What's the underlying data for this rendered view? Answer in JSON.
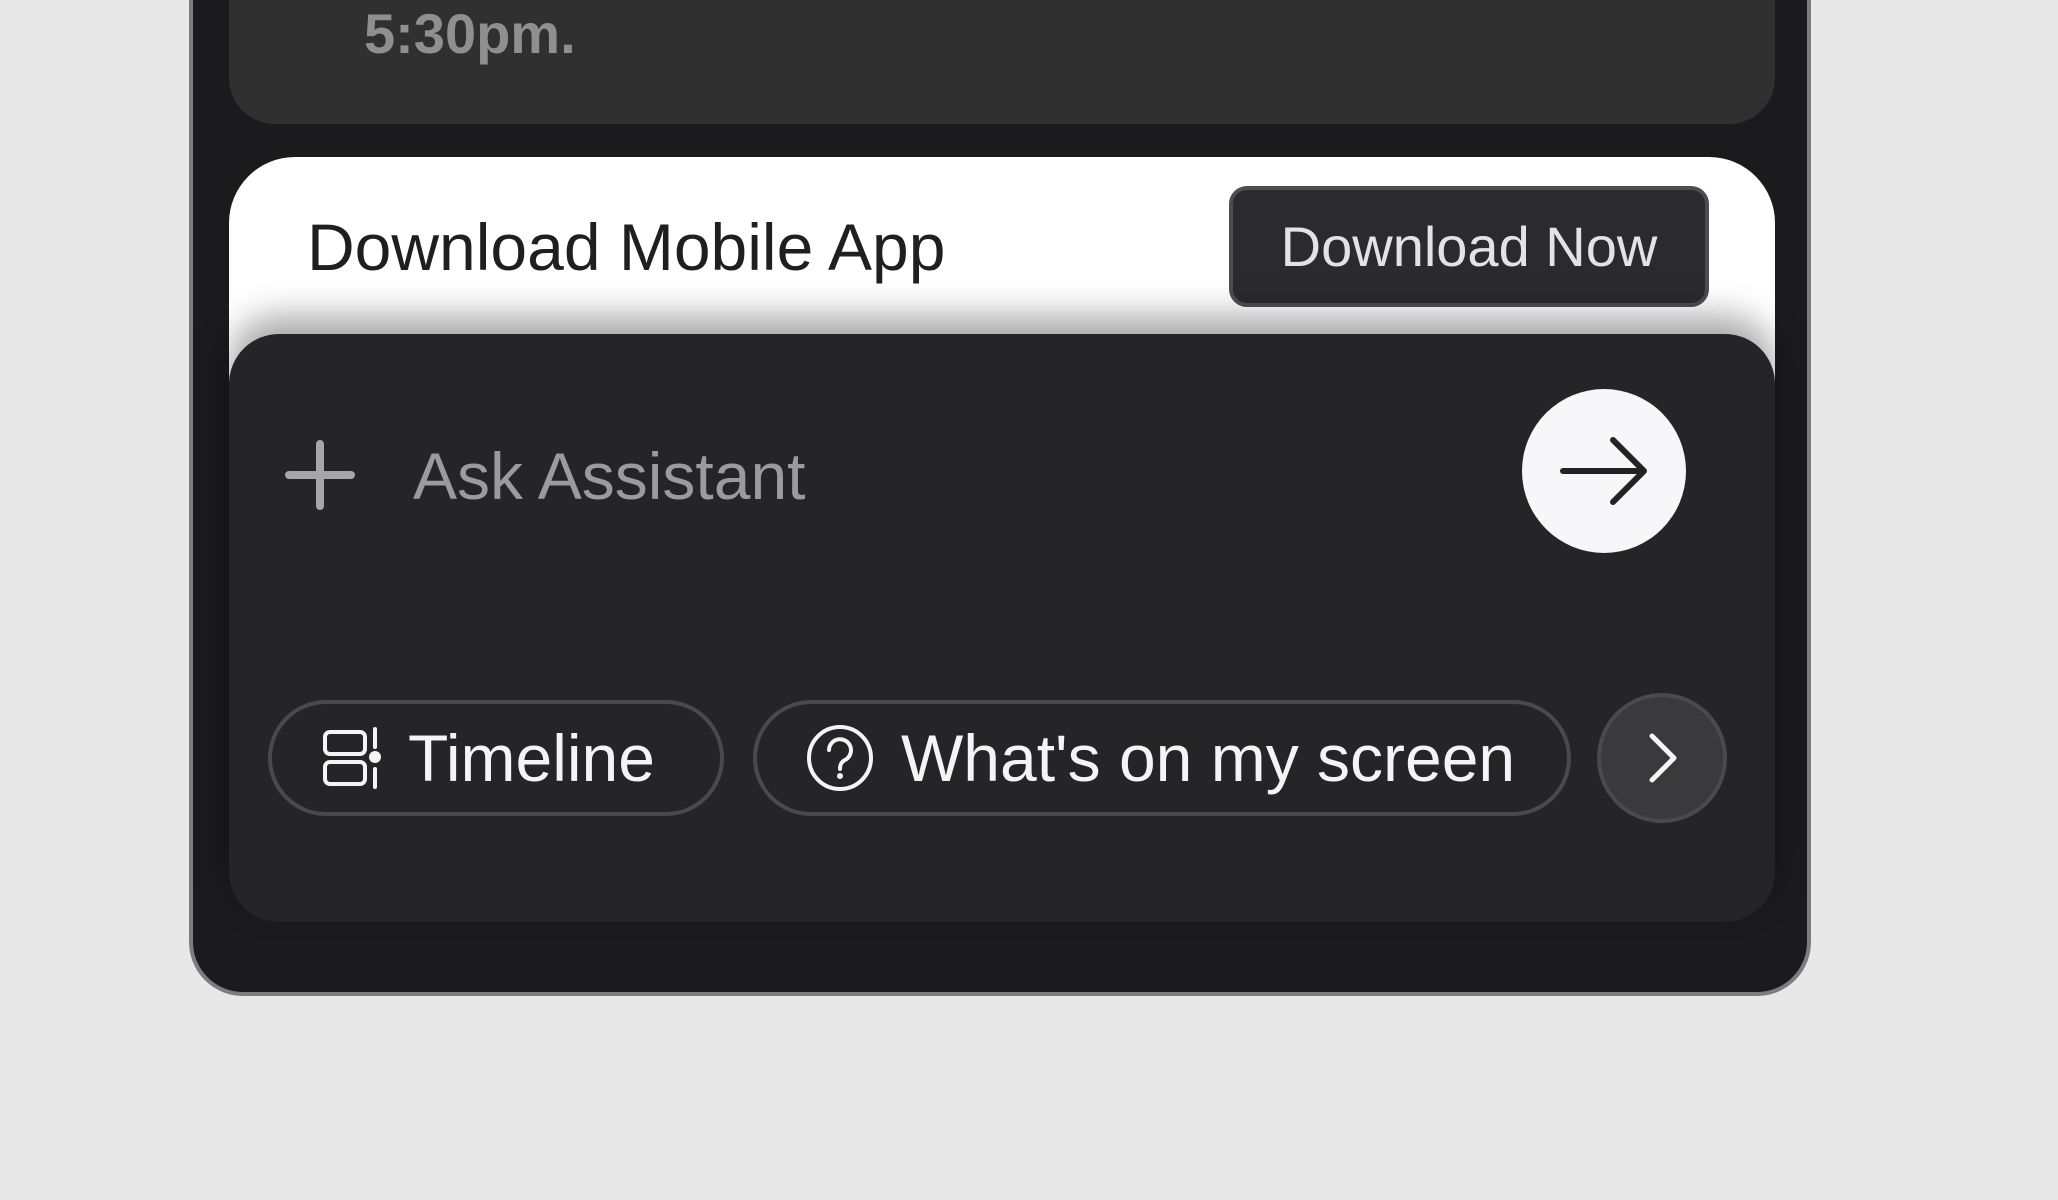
{
  "previous_message": {
    "text": "5:30pm."
  },
  "download_banner": {
    "title": "Download Mobile App",
    "button_label": "Download Now"
  },
  "assistant": {
    "input_placeholder": "Ask Assistant",
    "add_icon": "plus-icon",
    "send_icon": "arrow-right-icon",
    "chips": [
      {
        "label": "Timeline",
        "icon": "timeline-icon"
      },
      {
        "label": "What's on my screen",
        "icon": "question-circle-icon"
      }
    ],
    "more_icon": "chevron-right-icon"
  },
  "colors": {
    "page_background": "#e8e8e8",
    "device_background": "#1b1b1d",
    "panel_background": "#252528",
    "banner_background": "#ffffff",
    "send_button": "#f7f6f9"
  }
}
